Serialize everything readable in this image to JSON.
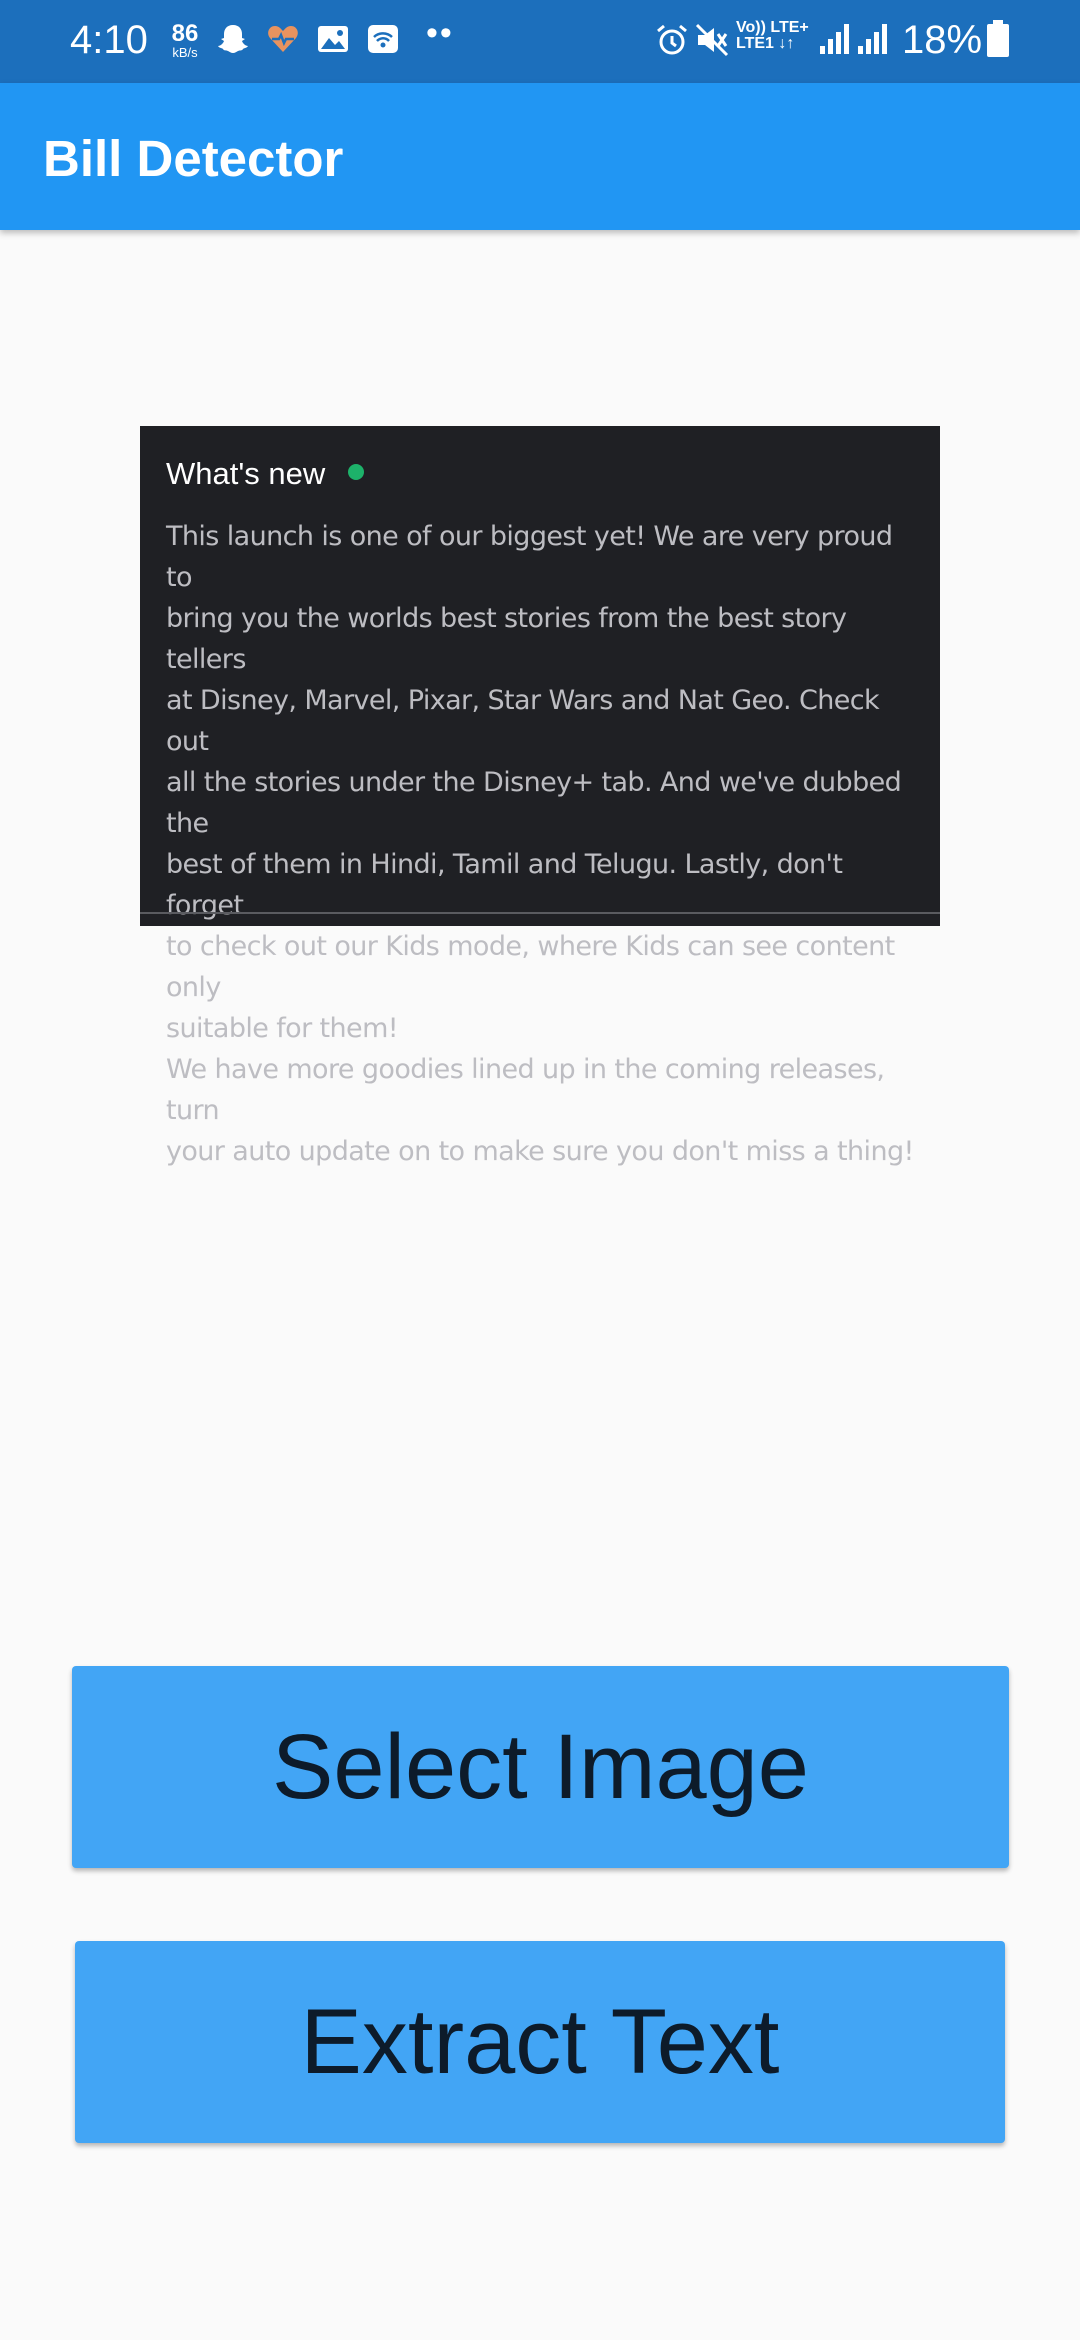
{
  "status_bar": {
    "time": "4:10",
    "net_speed_value": "86",
    "net_speed_unit": "kB/s",
    "overflow_dots": "••",
    "network_top": "Vo)) LTE+",
    "network_bottom": "LTE1 ↓↑",
    "battery_percent": "18%",
    "icons": [
      "snapchat-icon",
      "health-icon",
      "gallery-icon",
      "wifi-calling-icon",
      "alarm-icon",
      "mute-icon",
      "signal-icon",
      "signal-icon",
      "battery-icon"
    ]
  },
  "app_bar": {
    "title": "Bill Detector",
    "color": "#2196f3"
  },
  "preview": {
    "header": "What's new",
    "body": "This launch is one of our biggest yet! We are very proud to\nbring you the worlds best stories from the best story tellers\nat Disney, Marvel, Pixar, Star Wars and Nat Geo. Check out\nall the stories under the Disney+ tab. And we've dubbed the\nbest of them in Hindi, Tamil and Telugu. Lastly, don't forget\nto check out our Kids mode, where Kids can see content only\nsuitable for them!\nWe have more goodies lined up in the coming releases, turn\nyour auto update on to make sure you don't miss a thing!"
  },
  "buttons": {
    "select_image": "Select Image",
    "extract_text": "Extract Text",
    "color": "#42a5f5"
  }
}
